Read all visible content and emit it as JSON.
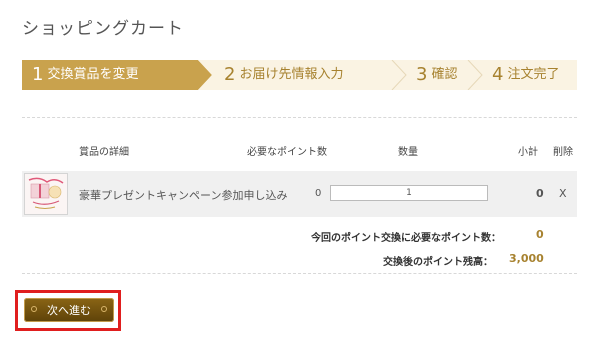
{
  "page": {
    "title": "ショッピングカート"
  },
  "steps": [
    {
      "num": "1",
      "label": "交換賞品を変更",
      "active": true
    },
    {
      "num": "2",
      "label": "お届け先情報入力",
      "active": false
    },
    {
      "num": "3",
      "label": "確認",
      "active": false
    },
    {
      "num": "4",
      "label": "注文完了",
      "active": false
    }
  ],
  "table": {
    "headers": {
      "detail": "賞品の詳細",
      "points": "必要なポイント数",
      "quantity": "数量",
      "subtotal": "小計",
      "delete": "削除"
    },
    "rows": [
      {
        "name": "豪華プレゼントキャンペーン参加申し込み",
        "points": "0",
        "quantity": "1",
        "subtotal": "0",
        "delete": "X"
      }
    ]
  },
  "summary": {
    "required_label": "今回のポイント交換に必要なポイント数：",
    "required_value": "0",
    "remaining_label": "交換後のポイント残高：",
    "remaining_value": "3,000"
  },
  "actions": {
    "next_label": "次へ進む"
  },
  "colors": {
    "accent": "#c9a24d",
    "accent_text": "#a7822f",
    "step_inactive_bg": "#faf3e3",
    "highlight": "#e01e1e",
    "button": "#6f4f0f"
  }
}
